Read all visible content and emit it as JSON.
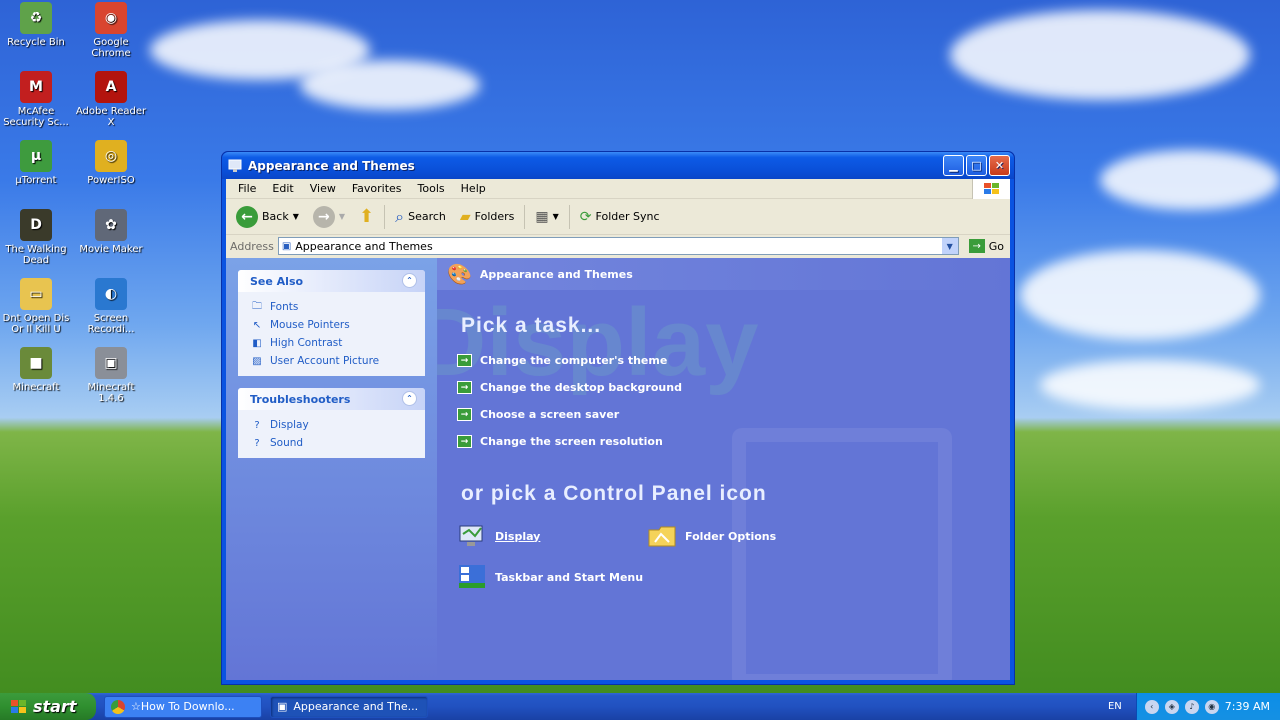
{
  "desktop": {
    "icons": [
      {
        "label": "Recycle Bin",
        "glyph": "♻",
        "bg": "#5fa24a"
      },
      {
        "label": "Google Chrome",
        "glyph": "◉",
        "bg": "#d9452f"
      },
      {
        "label": "McAfee Security Sc...",
        "glyph": "M",
        "bg": "#c21f1f"
      },
      {
        "label": "Adobe Reader X",
        "glyph": "A",
        "bg": "#b3140e"
      },
      {
        "label": "µTorrent",
        "glyph": "µ",
        "bg": "#3e9b3e"
      },
      {
        "label": "PowerISO",
        "glyph": "◎",
        "bg": "#e0b020"
      },
      {
        "label": "The Walking Dead",
        "glyph": "D",
        "bg": "#3a3a2a"
      },
      {
        "label": "Movie Maker",
        "glyph": "✿",
        "bg": "#606878"
      },
      {
        "label": "Dnt Open Dis Or Il Kill U",
        "glyph": "▭",
        "bg": "#e8c450"
      },
      {
        "label": "Screen Recordi...",
        "glyph": "◐",
        "bg": "#2a78d0"
      },
      {
        "label": "Minecraft",
        "glyph": "■",
        "bg": "#6a8a3a"
      },
      {
        "label": "Minecraft 1.4.6",
        "glyph": "▣",
        "bg": "#8a8f98"
      }
    ]
  },
  "window": {
    "title": "Appearance and Themes",
    "menu": [
      "File",
      "Edit",
      "View",
      "Favorites",
      "Tools",
      "Help"
    ],
    "toolbar": {
      "back": "Back",
      "search": "Search",
      "folders": "Folders",
      "folder_sync": "Folder Sync"
    },
    "address": {
      "label": "Address",
      "value": "Appearance and Themes",
      "go": "Go"
    },
    "see_also": {
      "title": "See Also",
      "items": [
        {
          "label": "Fonts",
          "icon": "fonts-icon"
        },
        {
          "label": "Mouse Pointers",
          "icon": "mouse-icon"
        },
        {
          "label": "High Contrast",
          "icon": "contrast-icon"
        },
        {
          "label": "User Account Picture",
          "icon": "picture-icon"
        }
      ]
    },
    "troubleshooters": {
      "title": "Troubleshooters",
      "items": [
        {
          "label": "Display",
          "icon": "help-icon"
        },
        {
          "label": "Sound",
          "icon": "help-icon"
        }
      ]
    },
    "main": {
      "header": "Appearance and Themes",
      "watermark": "Display",
      "pick_task": "Pick a task...",
      "tasks": [
        "Change the computer's theme",
        "Change the desktop background",
        "Choose a screen saver",
        "Change the screen resolution"
      ],
      "or_pick": "or pick a Control Panel icon",
      "icons": [
        {
          "label": "Display"
        },
        {
          "label": "Folder Options"
        },
        {
          "label": "Taskbar and Start Menu"
        }
      ]
    }
  },
  "taskbar": {
    "start": "start",
    "buttons": [
      {
        "label": "☆How To Downlo..."
      },
      {
        "label": "Appearance and The..."
      }
    ],
    "lang": "EN",
    "clock": "7:39 AM"
  },
  "colors": {
    "accent": "#215dc6",
    "pane": "#6375d6"
  }
}
